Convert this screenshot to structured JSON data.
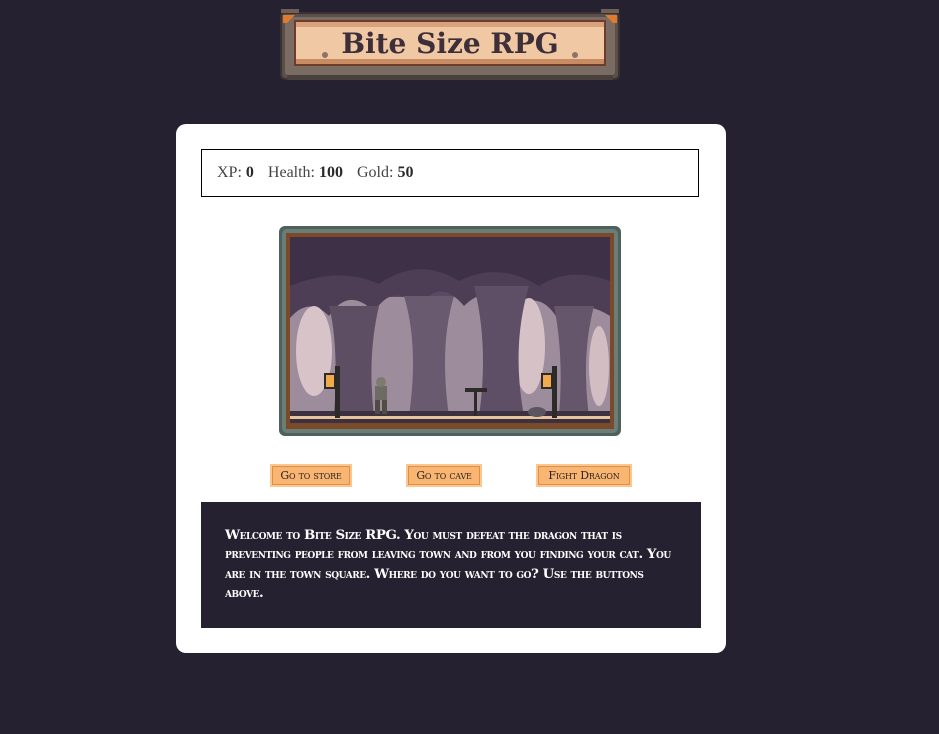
{
  "logo": {
    "title": "Bite Size RPG"
  },
  "stats": [
    {
      "label": "XP:",
      "value": "0"
    },
    {
      "label": "Health:",
      "value": "100"
    },
    {
      "label": "Gold:",
      "value": "50"
    }
  ],
  "scene": {
    "name": "forest-town-square"
  },
  "buttons": {
    "store": "Go to store",
    "cave": "Go to cave",
    "dragon": "Fight Dragon"
  },
  "text": "Welcome to Bite Size RPG. You must defeat the dragon that is preventing people from leaving town and from you finding your cat. You are in the town square. Where do you want to go? Use the buttons above.",
  "colors": {
    "background": "#262130",
    "card": "#ffffff",
    "button": "#f9b572",
    "text_panel": "#262130"
  }
}
